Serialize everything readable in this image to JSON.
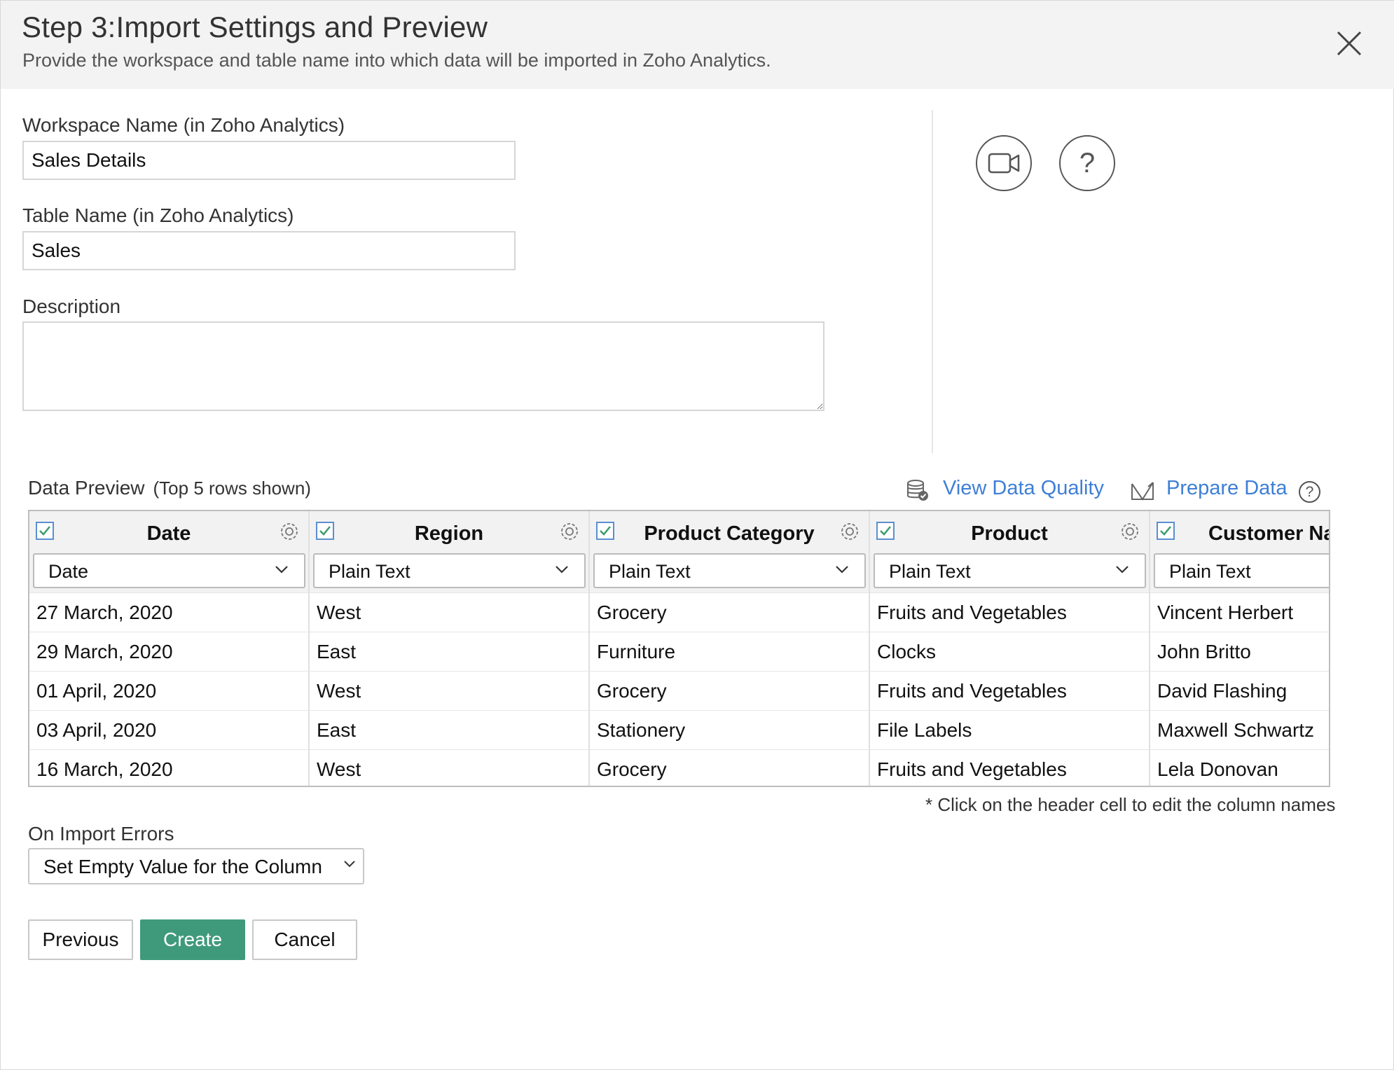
{
  "header": {
    "title": "Step 3:Import Settings and Preview",
    "subtitle": "Provide the workspace and table name into which data will be imported in Zoho Analytics."
  },
  "form": {
    "workspace_label": "Workspace Name (in Zoho Analytics)",
    "workspace_value": "Sales Details",
    "table_label": "Table Name (in Zoho Analytics)",
    "table_value": "Sales",
    "description_label": "Description",
    "description_value": ""
  },
  "side_icons": {
    "video": "video-camera-icon",
    "help": "?"
  },
  "preview": {
    "label": "Data Preview",
    "sublabel": "(Top 5 rows shown)",
    "view_quality_label": "View Data Quality",
    "prepare_label": "Prepare Data",
    "help_glyph": "?",
    "columns": [
      {
        "name": "Date",
        "type": "Date"
      },
      {
        "name": "Region",
        "type": "Plain Text"
      },
      {
        "name": "Product Category",
        "type": "Plain Text"
      },
      {
        "name": "Product",
        "type": "Plain Text"
      },
      {
        "name": "Customer Na",
        "type": "Plain Text"
      }
    ],
    "rows": [
      [
        "27 March, 2020",
        "West",
        "Grocery",
        "Fruits and Vegetables",
        "Vincent Herbert"
      ],
      [
        "29 March, 2020",
        "East",
        "Furniture",
        "Clocks",
        "John Britto"
      ],
      [
        "01 April, 2020",
        "West",
        "Grocery",
        "Fruits and Vegetables",
        "David Flashing"
      ],
      [
        "03 April, 2020",
        "East",
        "Stationery",
        "File Labels",
        "Maxwell Schwartz"
      ],
      [
        "16 March, 2020",
        "West",
        "Grocery",
        "Fruits and Vegetables",
        "Lela Donovan"
      ]
    ],
    "note": "* Click on the header cell to edit the column names"
  },
  "errors": {
    "label": "On Import Errors",
    "selected": "Set Empty Value for the Column"
  },
  "buttons": {
    "previous": "Previous",
    "create": "Create",
    "cancel": "Cancel"
  },
  "colors": {
    "accent": "#3e7fd6",
    "primary_button": "#3f9a7b",
    "header_bg": "#f3f3f3"
  }
}
